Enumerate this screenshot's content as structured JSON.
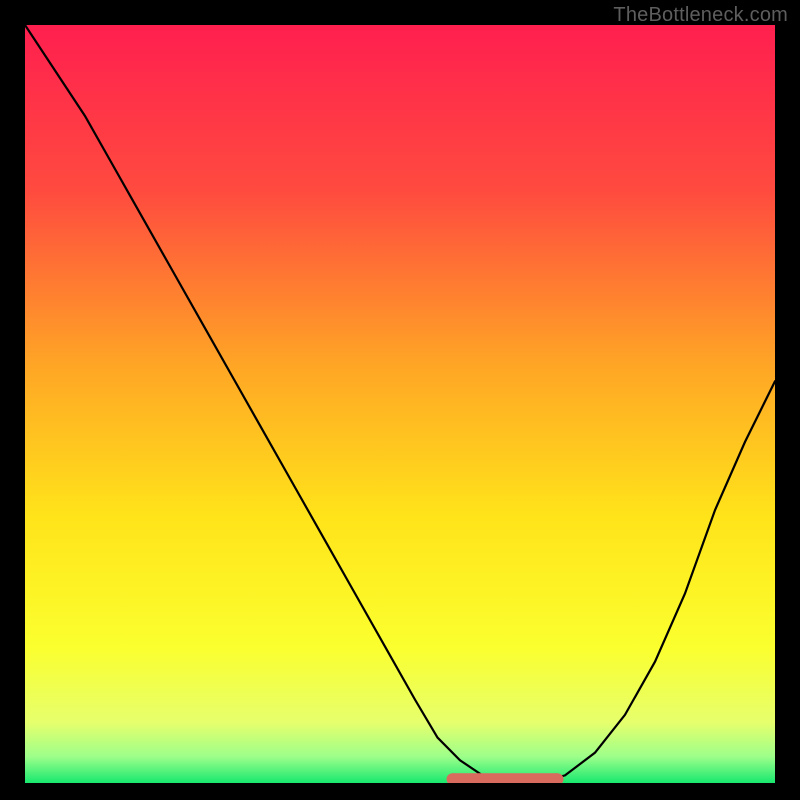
{
  "watermark": "TheBottleneck.com",
  "chart_data": {
    "type": "line",
    "title": "",
    "xlabel": "",
    "ylabel": "",
    "xlim": [
      0,
      100
    ],
    "ylim": [
      0,
      100
    ],
    "grid": false,
    "legend": false,
    "background_gradient": [
      {
        "pos": 0.0,
        "color": "#ff1f4f"
      },
      {
        "pos": 0.22,
        "color": "#ff4b3f"
      },
      {
        "pos": 0.45,
        "color": "#ffa625"
      },
      {
        "pos": 0.65,
        "color": "#ffe41a"
      },
      {
        "pos": 0.82,
        "color": "#fbff2e"
      },
      {
        "pos": 0.92,
        "color": "#e6ff6c"
      },
      {
        "pos": 0.965,
        "color": "#9dff8a"
      },
      {
        "pos": 1.0,
        "color": "#19e86f"
      }
    ],
    "series": [
      {
        "name": "bottleneck-curve",
        "stroke": "#000000",
        "x": [
          0,
          4,
          8,
          12,
          16,
          20,
          24,
          28,
          32,
          36,
          40,
          44,
          48,
          52,
          55,
          58,
          61,
          64,
          68,
          72,
          76,
          80,
          84,
          88,
          92,
          96,
          100
        ],
        "y": [
          100,
          94,
          88,
          81,
          74,
          67,
          60,
          53,
          46,
          39,
          32,
          25,
          18,
          11,
          6,
          3,
          1,
          0,
          0,
          1,
          4,
          9,
          16,
          25,
          36,
          45,
          53
        ]
      }
    ],
    "marker": {
      "name": "optimal-range-marker",
      "color": "#d96b5e",
      "x_range": [
        57,
        71
      ],
      "y": 0.5,
      "thickness": 12,
      "endcap_radius": 6
    }
  }
}
